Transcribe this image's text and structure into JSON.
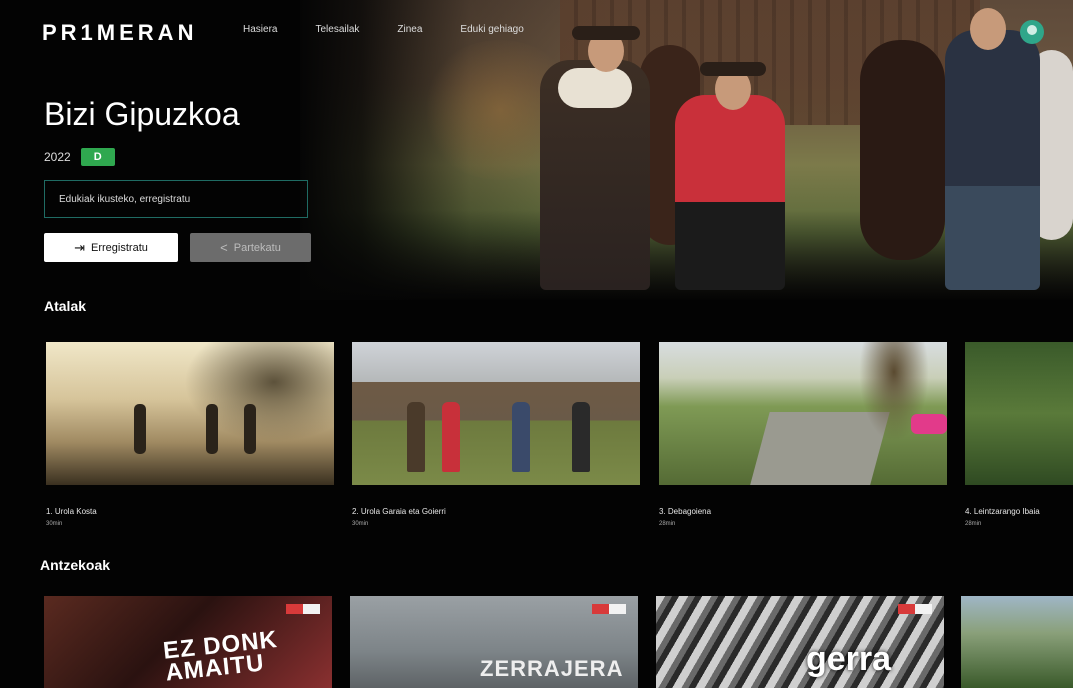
{
  "header": {
    "logo": "PR1MERAN",
    "nav": [
      "Hasiera",
      "Telesailak",
      "Zinea",
      "Eduki gehiago"
    ]
  },
  "hero": {
    "title": "Bizi Gipuzkoa",
    "year": "2022",
    "rating": "D",
    "notice": "Edukiak ikusteko, erregistratu",
    "register_label": "Erregistratu",
    "share_label": "Partekatu"
  },
  "episodes": {
    "title": "Atalak",
    "items": [
      {
        "label": "1. Urola Kosta",
        "duration": "30min"
      },
      {
        "label": "2. Urola Garaia eta Goierri",
        "duration": "30min"
      },
      {
        "label": "3. Debagoiena",
        "duration": "28min"
      },
      {
        "label": "4. Leintzarango Ibaia",
        "duration": "28min"
      }
    ]
  },
  "similar": {
    "title": "Antzekoak",
    "items": [
      {
        "overlay": "EZ DONK AMAITU"
      },
      {
        "overlay": "ZERRAJERA"
      },
      {
        "overlay": "gerra"
      },
      {
        "overlay": ""
      }
    ]
  },
  "colors": {
    "accent": "#2fa68a",
    "rating_badge": "#2fa84f",
    "background": "#030303"
  }
}
